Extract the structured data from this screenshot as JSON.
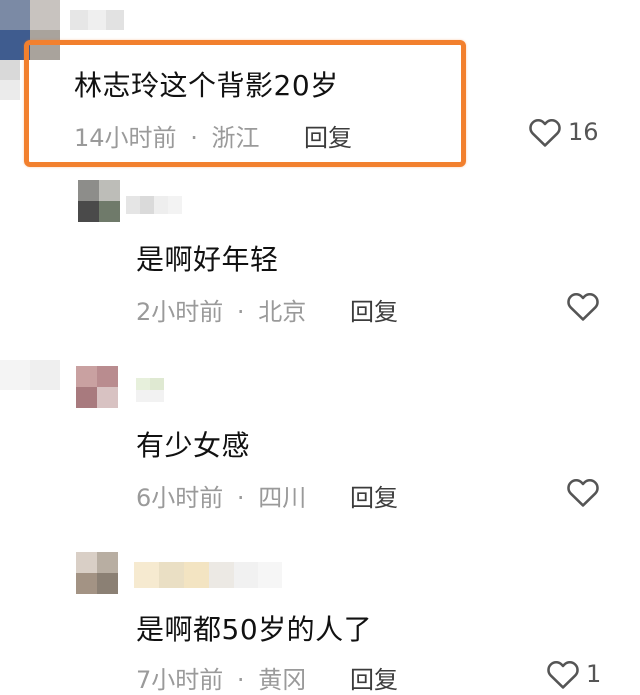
{
  "comments": [
    {
      "text": "林志玲这个背影20岁",
      "time": "14小时前",
      "sep": "·",
      "location": "浙江",
      "reply_label": "回复",
      "likes": "16",
      "highlighted": true
    },
    {
      "text": "是啊好年轻",
      "time": "2小时前",
      "sep": "·",
      "location": "北京",
      "reply_label": "回复",
      "likes": ""
    },
    {
      "text": "有少女感",
      "time": "6小时前",
      "sep": "·",
      "location": "四川",
      "reply_label": "回复",
      "likes": ""
    },
    {
      "text": "是啊都50岁的人了",
      "time": "7小时前",
      "sep": "·",
      "location": "黄冈",
      "reply_label": "回复",
      "likes": "1"
    }
  ],
  "colors": {
    "highlight": "#f2802e",
    "meta": "#9a9a9a",
    "text": "#111111"
  },
  "icons": {
    "like": "heart-outline-icon"
  }
}
